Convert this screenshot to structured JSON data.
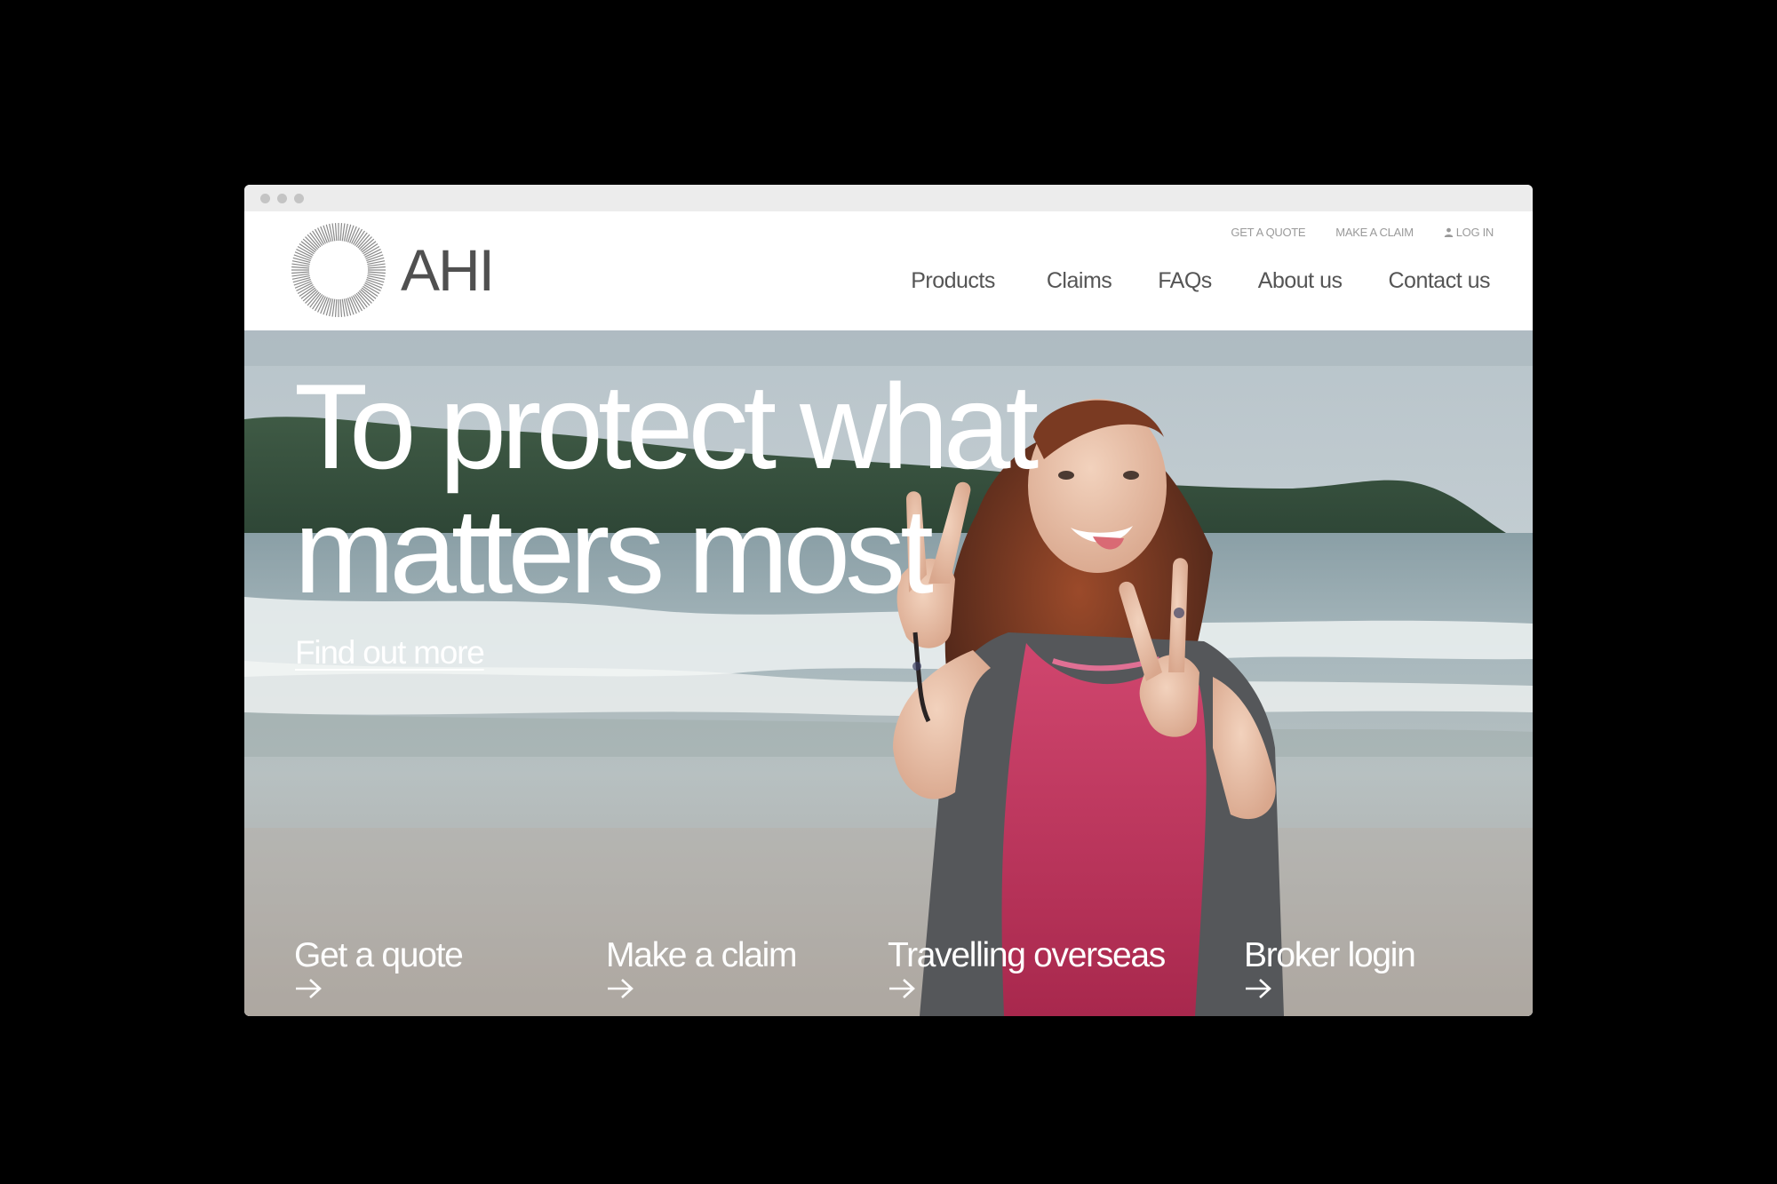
{
  "brand": {
    "name": "AHI"
  },
  "utility_nav": {
    "get_quote": "GET A QUOTE",
    "make_claim": "MAKE A CLAIM",
    "log_in": "LOG IN"
  },
  "main_nav": {
    "products": "Products",
    "claims": "Claims",
    "faqs": "FAQs",
    "about": "About us",
    "contact": "Contact us"
  },
  "hero": {
    "headline_line1": "To protect what",
    "headline_line2": "matters most",
    "cta": "Find out more"
  },
  "quick_links": {
    "quote": "Get a quote",
    "claim": "Make a claim",
    "travel": "Travelling overseas",
    "broker": "Broker login"
  },
  "icons": {
    "logo": "sunburst-ring-icon",
    "login": "user-icon",
    "links": "arrow-right-icon"
  },
  "colors": {
    "background": "#000000",
    "nav_text": "#555555",
    "utility_text": "#9a9a9a",
    "hero_text": "#ffffff",
    "swimsuit": "#c23a62"
  }
}
